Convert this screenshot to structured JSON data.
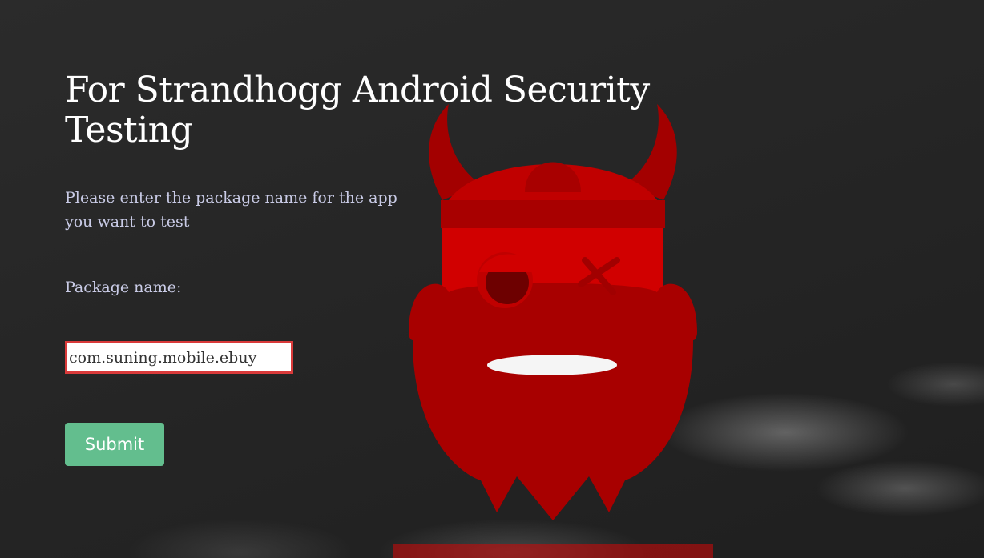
{
  "page": {
    "title": "For Strandhogg Android Security Testing",
    "intro": "Please enter the package name for the app you want to test",
    "package_label": "Package name:",
    "package_value": "com.suning.mobile.ebuy",
    "submit_label": "Submit"
  },
  "colors": {
    "background": "#262626",
    "text": "#c9cbe6",
    "title": "#ffffff",
    "submit": "#63be8e",
    "input_border": "#d93a3a",
    "mascot_red": "#c40a0a"
  },
  "icons": {
    "mascot": "strandhogg-viking-devil-icon"
  }
}
